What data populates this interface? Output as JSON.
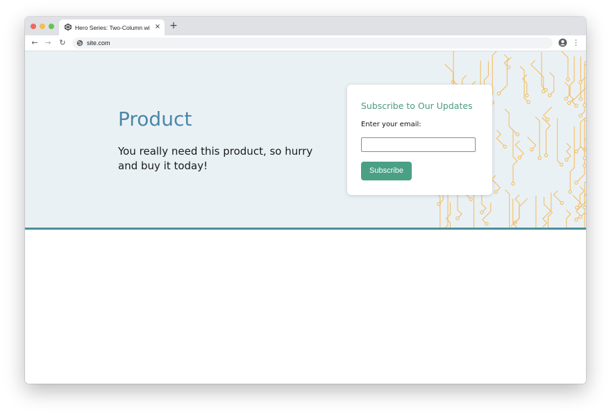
{
  "browser": {
    "tab_title": "Hero Series: Two-Column with",
    "tab_close": "×",
    "new_tab": "+",
    "url": "site.com",
    "nav_back": "←",
    "nav_forward": "→",
    "nav_reload": "↻",
    "profile_icon": "account-circle-icon",
    "menu_icon": "⋮"
  },
  "hero": {
    "title": "Product",
    "subtitle": "You really need this product, so hurry and buy it today!"
  },
  "subscribe": {
    "title": "Subscribe to Our Updates",
    "email_label": "Enter your email:",
    "email_value": "",
    "email_placeholder": "",
    "button_label": "Subscribe"
  },
  "colors": {
    "hero_background": "#eaf1f5",
    "hero_border": "#4a8f9a",
    "title": "#4a86a8",
    "card_title": "#4a9a82",
    "button": "#4aa084",
    "circuit": "#f3be62"
  }
}
